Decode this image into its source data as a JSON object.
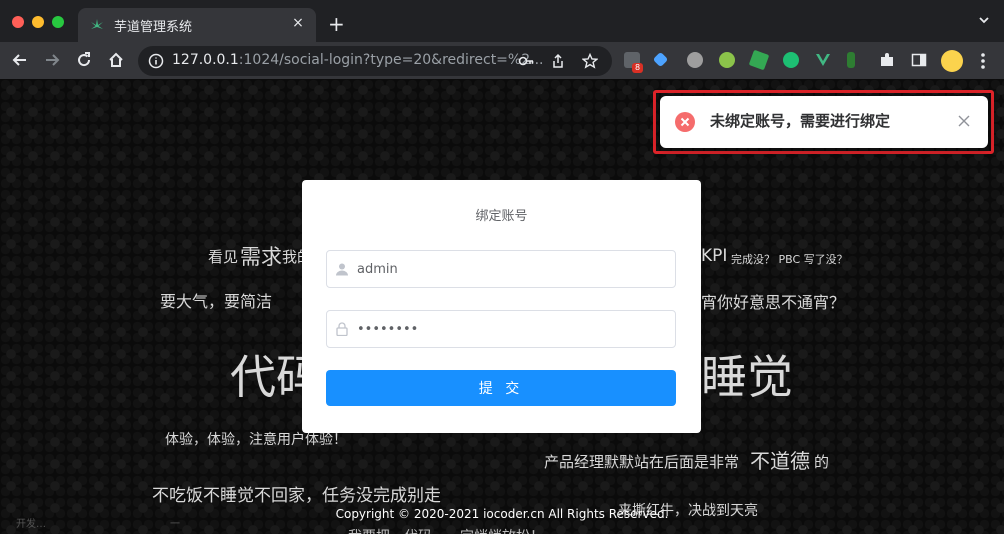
{
  "browser": {
    "tab_title": "芋道管理系统",
    "tab_close": "×",
    "new_tab": "+",
    "url_host": "127.0.0.1",
    "url_rest": ":1024/social-login?type=20&redirect=%2...",
    "extension_badge": "8"
  },
  "login_card": {
    "title": "绑定账号",
    "username_value": "admin",
    "password_value": "••••••••",
    "submit_label": "提 交"
  },
  "background_text": {
    "line1a": "看见",
    "line1b": "需求",
    "line1c": "我的",
    "line1d": "KPI",
    "line1e": "完成没？ PBC 写了没？",
    "line2a": "要大气，要简洁",
    "line2b": "宵你好意思不通宵？",
    "line3a": "代码",
    "line3b": "睡觉",
    "line4a": "体验，体验，注意用户体验！",
    "line4b": "产品经理默默站在后面是非常",
    "line4c": "不道德",
    "line4d": "的",
    "line5a": "不吃饭不睡觉不回家，任务没完成别走",
    "line5b": "来撕红牛，决战到天亮",
    "line6a": "我要把…代码…一定悄悄放松！",
    "line6b": "开发…",
    "line6c": "一"
  },
  "footer": {
    "copyright": "Copyright © 2020-2021 iocoder.cn All Rights Reserved."
  },
  "notification": {
    "message": "未绑定账号，需要进行绑定",
    "type": "error",
    "highlight_color": "#e0242a"
  },
  "colors": {
    "primary": "#1890ff",
    "error": "#f56c6c"
  }
}
